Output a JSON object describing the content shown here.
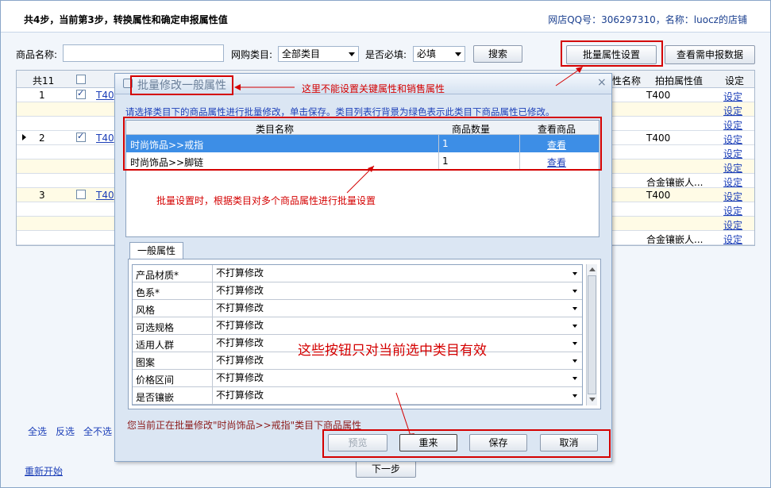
{
  "header": {
    "title": "共4步，当前第3步，转换属性和确定申报属性值",
    "shop_info": "网店QQ号：306297310，名称：luocz的店铺"
  },
  "filters": {
    "product_name_label": "商品名称:",
    "product_name_value": "",
    "category_label": "网购类目:",
    "category_value": "全部类目",
    "required_label": "是否必填:",
    "required_value": "必填",
    "search_button": "搜索",
    "batch_button": "批量属性设置",
    "view_button": "查看需申报数据"
  },
  "grid": {
    "count_label": "共11",
    "headers": [
      "性名称",
      "拍拍属性值",
      "设定"
    ],
    "rows": [
      {
        "num": "1",
        "checked": true,
        "link": "T40",
        "attr": "T400",
        "set": "设定"
      },
      {
        "num": "",
        "checked": false,
        "link": "",
        "attr": "",
        "set": "设定"
      },
      {
        "num": "",
        "checked": false,
        "link": "",
        "attr": "",
        "set": "设定"
      },
      {
        "num": "2",
        "checked": true,
        "link": "T40",
        "attr": "T400",
        "set": "设定"
      },
      {
        "num": "",
        "checked": false,
        "link": "",
        "attr": "",
        "set": "设定"
      },
      {
        "num": "",
        "checked": false,
        "link": "",
        "attr": "",
        "set": "设定"
      },
      {
        "num": "",
        "checked": false,
        "link": "",
        "attr": "合金镶嵌人...",
        "set": "设定"
      },
      {
        "num": "3",
        "checked": false,
        "link": "T40",
        "attr": "T400",
        "set": "设定"
      },
      {
        "num": "",
        "checked": false,
        "link": "",
        "attr": "",
        "set": "设定"
      },
      {
        "num": "",
        "checked": false,
        "link": "",
        "attr": "",
        "set": "设定"
      },
      {
        "num": "",
        "checked": false,
        "link": "",
        "attr": "合金镶嵌人...",
        "set": "设定"
      }
    ]
  },
  "bottom": {
    "select_all": "全选",
    "invert": "反选",
    "select_none": "全不选",
    "restart": "重新开始",
    "next": "下一步"
  },
  "dialog": {
    "title": "批量修改一般属性",
    "annotation_title": "这里不能设置关键属性和销售属性",
    "instruction": "请选择类目下的商品属性进行批量修改，单击保存。类目列表行背景为绿色表示此类目下商品属性已修改。",
    "table_headers": [
      "类目名称",
      "商品数量",
      "查看商品"
    ],
    "categories": [
      {
        "name": "时尚饰品>>戒指",
        "count": "1",
        "view": "查看"
      },
      {
        "name": "时尚饰品>>脚链",
        "count": "1",
        "view": "查看"
      }
    ],
    "annotation_batch": "批量设置时，根据类目对多个商品属性进行批量设置",
    "tab_label": "一般属性",
    "properties": [
      {
        "name": "产品材质*",
        "value": "不打算修改"
      },
      {
        "name": "色系*",
        "value": "不打算修改"
      },
      {
        "name": "风格",
        "value": "不打算修改"
      },
      {
        "name": "可选规格",
        "value": "不打算修改"
      },
      {
        "name": "适用人群",
        "value": "不打算修改"
      },
      {
        "name": "图案",
        "value": "不打算修改"
      },
      {
        "name": "价格区间",
        "value": "不打算修改"
      },
      {
        "name": "是否镶嵌",
        "value": "不打算修改"
      }
    ],
    "annotation_buttons": "这些按钮只对当前选中类目有效",
    "status_text": "您当前正在批量修改\"时尚饰品>>戒指\"类目下商品属性",
    "preview_button": "预览",
    "reset_button": "重来",
    "save_button": "保存",
    "cancel_button": "取消"
  },
  "colors": {
    "annotation_red": "#d40000",
    "selected_row": "#3d8ee6",
    "link_blue": "#1c3fb8"
  }
}
